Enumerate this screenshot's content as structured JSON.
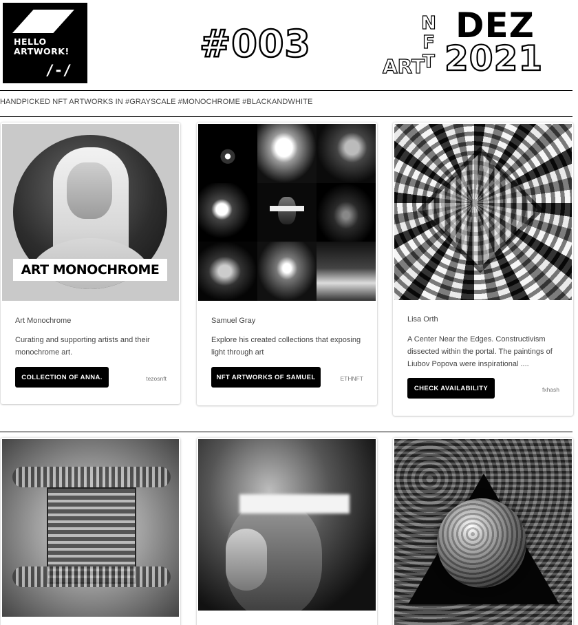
{
  "header": {
    "logo_text": [
      "HELLO",
      "ARTWORK!"
    ],
    "logo_mark": "/-/",
    "issue": "#003",
    "nft_vertical": [
      "N",
      "F",
      "T"
    ],
    "art": "ART",
    "month": "DEZ",
    "year": "2021"
  },
  "tagline": "HANDPICKED NFT ARTWORKS IN #GRAYSCALE #MONOCHROME #BLACKANDWHITE",
  "cards": [
    {
      "image_label": "ART MONOCHROME",
      "author": "Art Monochrome",
      "description": "Curating and supporting artists and their monochrome art.",
      "button": "COLLECTION OF ANNA.",
      "platform": "tezosnft"
    },
    {
      "author": "Samuel Gray",
      "description": "Explore his created collections that exposing light through art",
      "button": "NFT ARTWORKS OF SAMUEL",
      "platform": "ETHNFT"
    },
    {
      "author": "Lisa Orth",
      "description": "A Center Near the Edges. Constructivism dissected within the portal. The paintings of Liubov Popova were inspirational ....",
      "button": "CHECK AVAILABILITY",
      "platform": "fxhash"
    }
  ],
  "colors": {
    "primary": "#000000",
    "background": "#ffffff",
    "text": "#444444"
  }
}
